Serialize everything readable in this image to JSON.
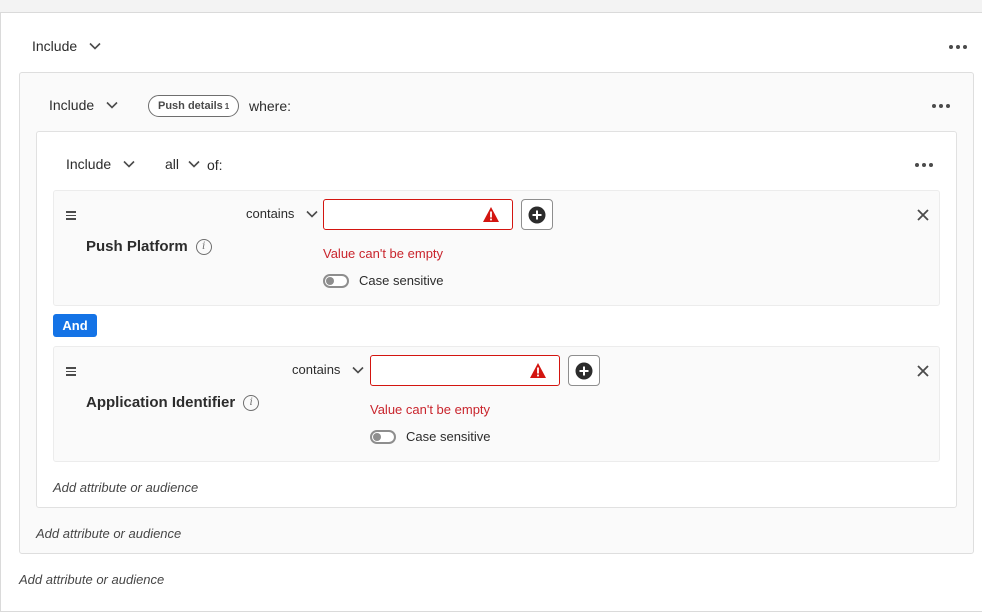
{
  "top": {
    "mode_label": "Include"
  },
  "push_group": {
    "mode_label": "Include",
    "pill_label": "Push details",
    "pill_sup": "1",
    "where_label": "where:"
  },
  "inner_group": {
    "mode_label": "Include",
    "quantifier_label": "all",
    "of_label": "of:"
  },
  "rules": [
    {
      "name": "Push Platform",
      "operator": "contains",
      "value": "",
      "error": "Value can't be empty",
      "case_label": "Case sensitive"
    },
    {
      "name": "Application Identifier",
      "operator": "contains",
      "value": "",
      "error": "Value can't be empty",
      "case_label": "Case sensitive"
    }
  ],
  "and_label": "And",
  "add_links": {
    "inner": "Add attribute or audience",
    "push_group": "Add attribute or audience",
    "top": "Add attribute or audience"
  },
  "colors": {
    "accent": "#1473e6",
    "error": "#c9252d",
    "error_border": "#d31510"
  },
  "icons": {
    "chevron": "chevron-down-icon",
    "more": "more-icon",
    "alert": "alert-icon",
    "add": "add-circle-icon",
    "close": "close-icon",
    "drag": "drag-handle-icon",
    "info": "info-icon"
  }
}
